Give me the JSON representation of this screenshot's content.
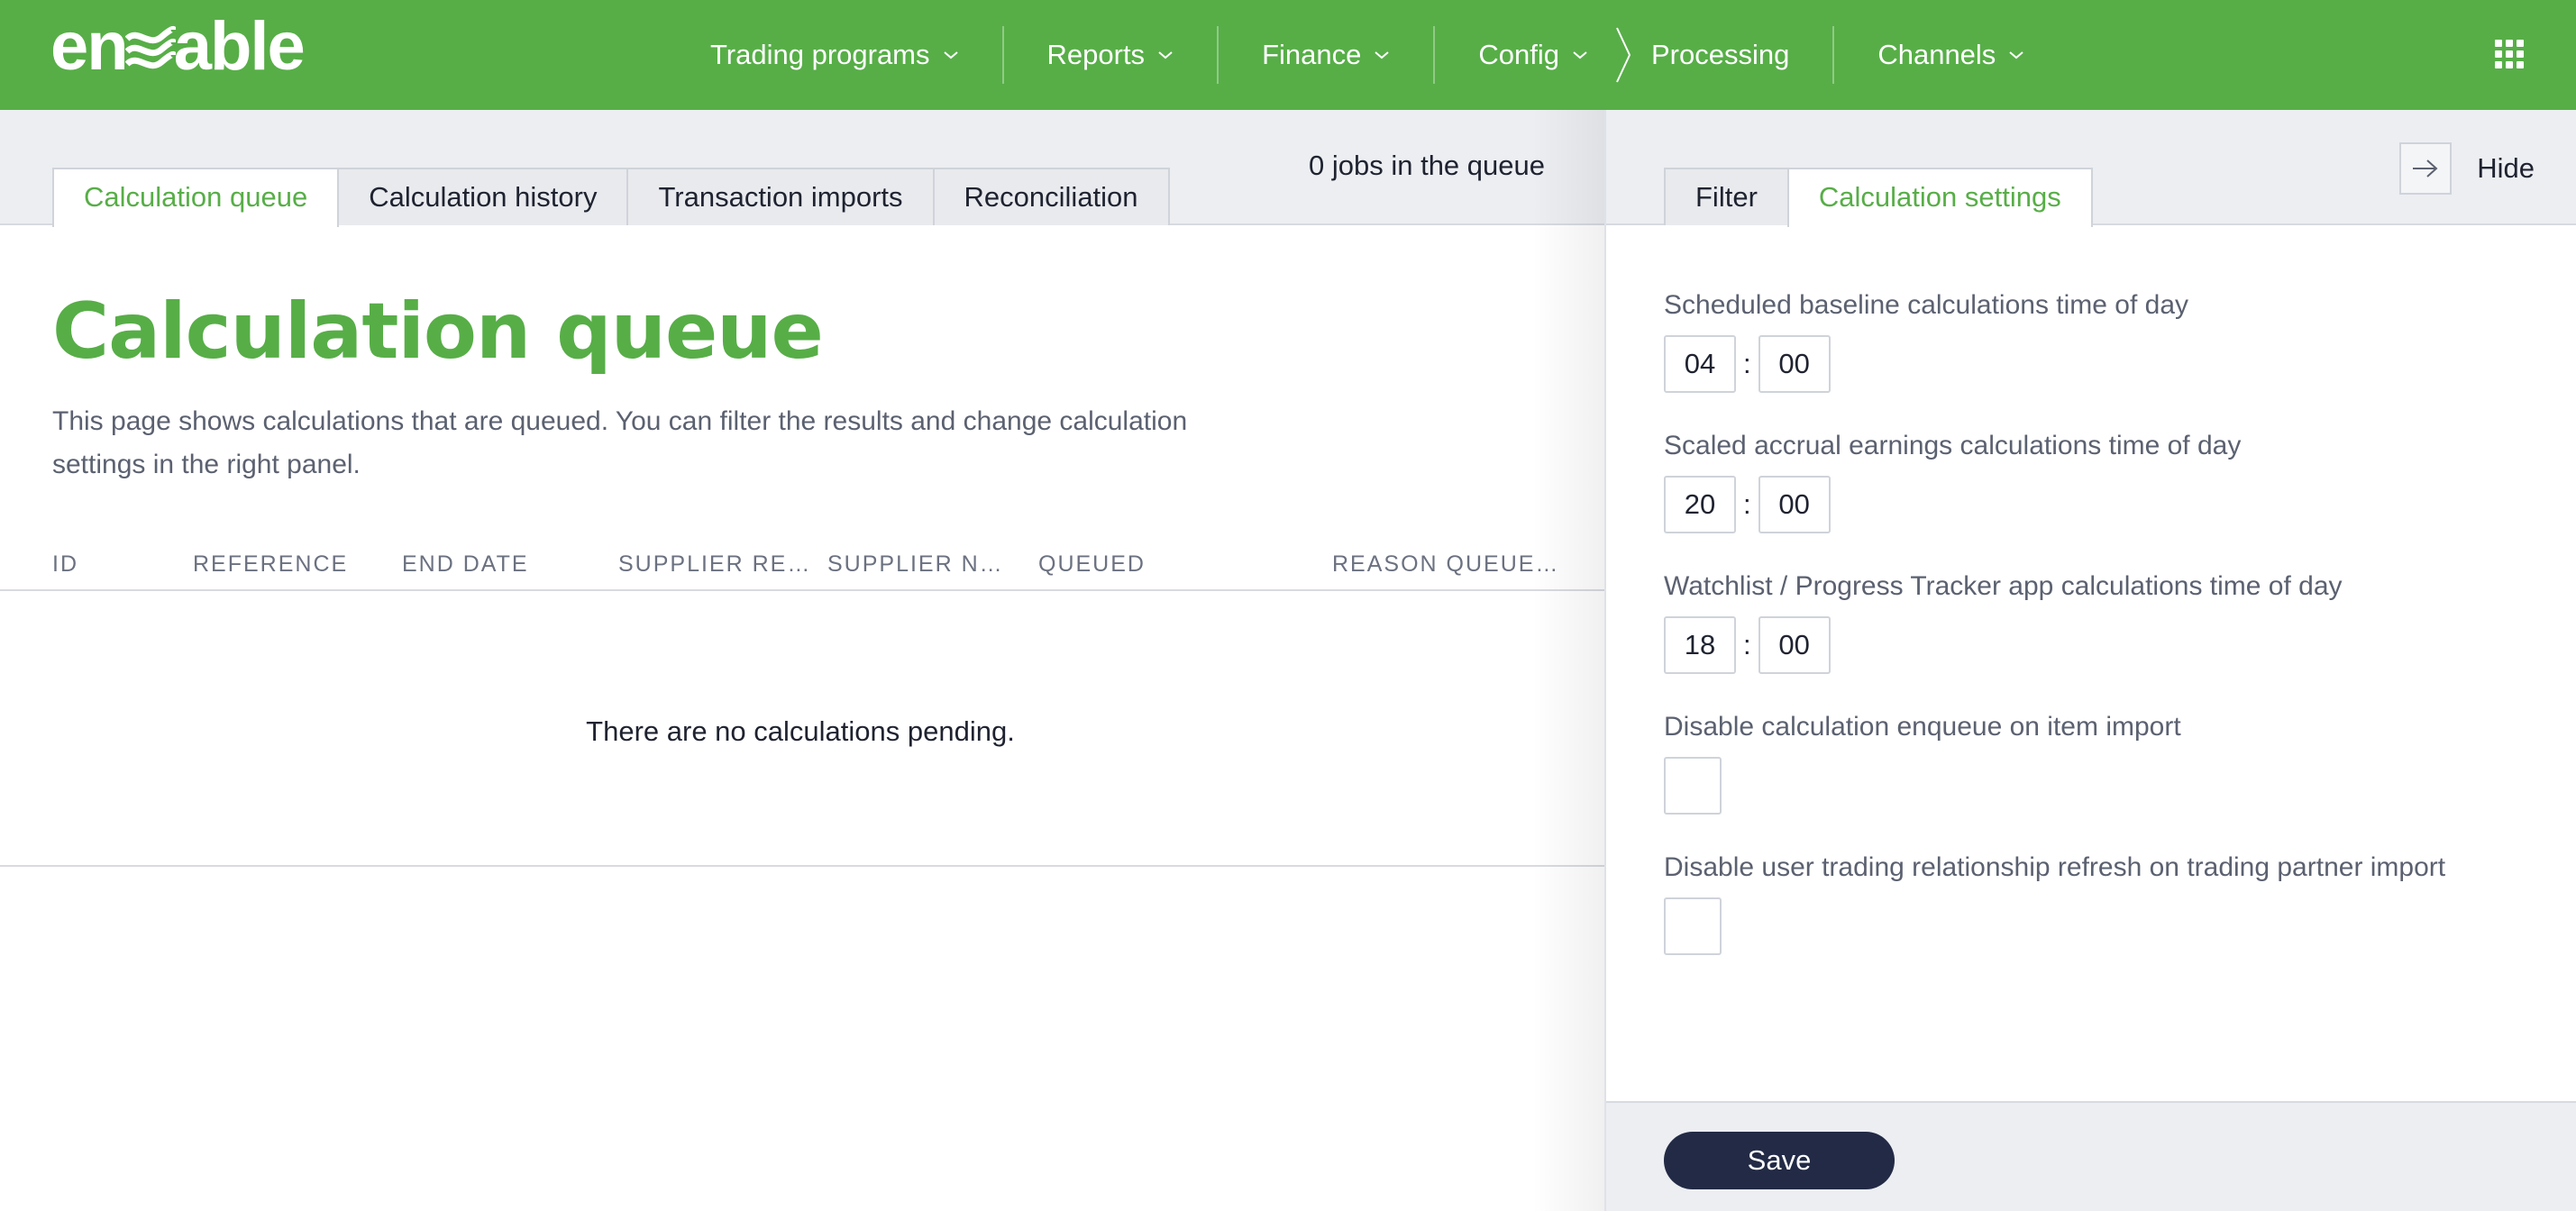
{
  "logo": {
    "text_left": "en",
    "text_right": "able"
  },
  "nav": {
    "items": [
      {
        "label": "Trading programs"
      },
      {
        "label": "Reports"
      },
      {
        "label": "Finance"
      },
      {
        "label": "Config"
      },
      {
        "label": "Processing"
      },
      {
        "label": "Channels"
      }
    ]
  },
  "main": {
    "tabs": [
      {
        "label": "Calculation queue"
      },
      {
        "label": "Calculation history"
      },
      {
        "label": "Transaction imports"
      },
      {
        "label": "Reconciliation"
      }
    ],
    "queue_count": "0 jobs in the queue",
    "title": "Calculation queue",
    "description": "This page shows calculations that are queued. You can filter the results and change calculation settings in the right panel.",
    "table": {
      "columns": [
        "ID",
        "REFERENCE",
        "END DATE",
        "SUPPLIER RE…",
        "SUPPLIER N…",
        "QUEUED",
        "REASON QUEUE…"
      ],
      "empty_message": "There are no calculations pending."
    }
  },
  "panel": {
    "tabs": [
      {
        "label": "Filter"
      },
      {
        "label": "Calculation settings"
      }
    ],
    "hide_label": "Hide",
    "settings": [
      {
        "label": "Scheduled baseline calculations time of day",
        "hour": "04",
        "minute": "00"
      },
      {
        "label": "Scaled accrual earnings calculations time of day",
        "hour": "20",
        "minute": "00"
      },
      {
        "label": "Watchlist / Progress Tracker app calculations time of day",
        "hour": "18",
        "minute": "00"
      }
    ],
    "checkboxes": [
      {
        "label": "Disable calculation enqueue on item import",
        "checked": false
      },
      {
        "label": "Disable user trading relationship refresh on trading partner import",
        "checked": false
      }
    ],
    "time_separator": ":",
    "save_label": "Save"
  },
  "colors": {
    "brand_green": "#57ae47",
    "save_button": "#222a45"
  }
}
